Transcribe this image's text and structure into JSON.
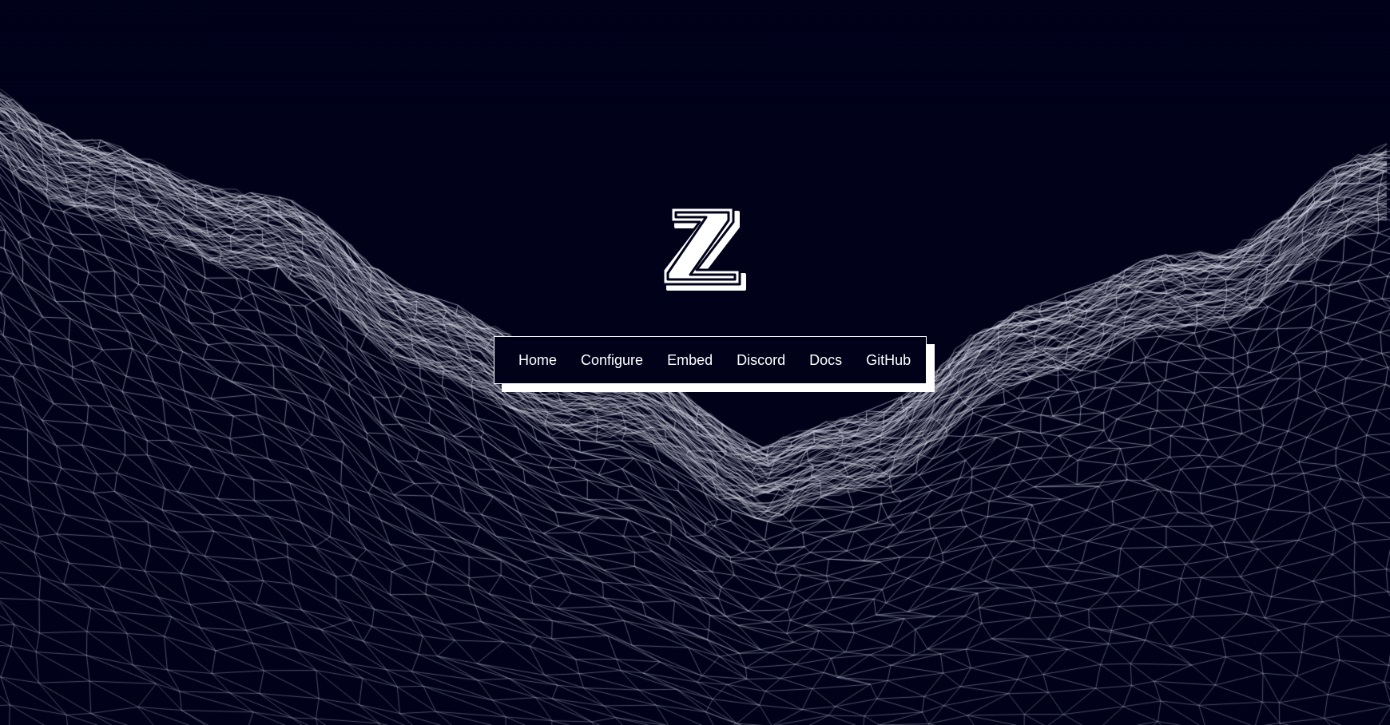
{
  "colors": {
    "background": "#01021a",
    "foreground": "#ffffff",
    "wireframe": "#c8cad8"
  },
  "background_graphic": "wireframe-mountain-terrain",
  "logo": {
    "icon": "z-logo-icon",
    "letter": "Z"
  },
  "nav": {
    "items": [
      {
        "label": "Home"
      },
      {
        "label": "Configure"
      },
      {
        "label": "Embed"
      },
      {
        "label": "Discord"
      },
      {
        "label": "Docs"
      },
      {
        "label": "GitHub"
      }
    ]
  }
}
